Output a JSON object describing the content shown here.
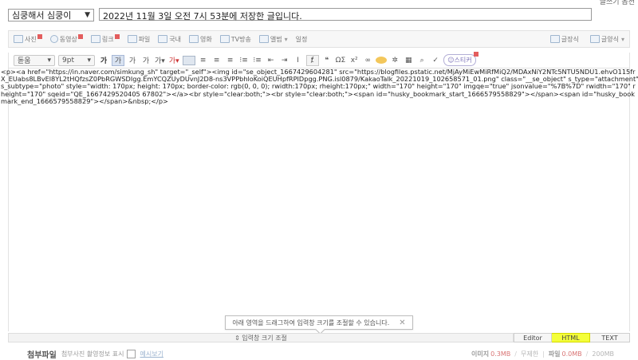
{
  "top_right_text": "글쓰기 옵션",
  "post": {
    "category": "심쿵해서 심쿵이",
    "title": "2022년 11월 3일 오전 7시 53분에 저장한 글입니다."
  },
  "toolbar1": {
    "items": [
      {
        "label": "사진",
        "icon": "camera-icon",
        "new": true
      },
      {
        "label": "동영상",
        "icon": "video-icon",
        "new": true
      },
      {
        "label": "링크",
        "icon": "link-icon",
        "new": true
      },
      {
        "label": "파일",
        "icon": "file-icon"
      },
      {
        "label": "국내",
        "icon": "map-icon"
      },
      {
        "label": "영화",
        "icon": "film-icon"
      },
      {
        "label": "TV방송",
        "icon": "tv-icon"
      },
      {
        "label": "앨범",
        "icon": "album-icon"
      },
      {
        "label": "일정",
        "icon": "calendar-icon"
      }
    ],
    "right": [
      {
        "label": "글장식",
        "icon": "decorate-icon"
      },
      {
        "label": "글양식",
        "icon": "template-icon"
      }
    ]
  },
  "toolbar2": {
    "font": "돋움",
    "size": "9pt",
    "sticker": "스티커"
  },
  "editor": {
    "html_source": "<p><a href=\"https://in.naver.com/simkung_sh\" target=\"_self\"><img id=\"se_object_1667429604281\" src=\"https://blogfiles.pstatic.net/MjAyMiEwMiRfMiQ2/MDAxNiY2NTc5NTU5NDU1.ehvO115frX_EUabs8LBvEl8YL2tHQfzsZ0PbRGWSDIgg.EmYCQZUyDUvnJ2D8-ns3VPPbhloKoiQEUHpfRPIDpgg.PNG.isl0879/KakaoTalk_20221019_102658571_01.png\" class=\"__se_object\" s_type=\"attachment\" s_subtype=\"photo\" style=\"width: 170px; height: 170px; border-color: rgb(0, 0, 0); rwidth:170px; rheight:170px;\" width=\"170\" height=\"170\" imgqe=\"true\" jsonvalue=\"%7B%7D\" rwidth=\"170\" rheight=\"170\" sqeid=\"QE_1667429520405 67802\"></a><br style=\"clear:both;\"><br style=\"clear:both;\"><span id=\"husky_bookmark_start_1666579558829\"></span><span id=\"husky_bookmark_end_1666579558829\"></span>&nbsp;</p>"
  },
  "tooltip": {
    "text": "아래 영역을 드래그하여 입력창 크기를 조절할 수 있습니다.",
    "close": "✕"
  },
  "resize_bar": "⇕ 입력창 크기 조절",
  "modes": {
    "editor": "Editor",
    "html": "HTML",
    "text": "TEXT",
    "active": "HTML"
  },
  "attachment": {
    "label": "첨부파일",
    "option": "첨부사진 촬영정보 표시",
    "example": "예시보기",
    "image_label": "이미지",
    "image_value": "0.3MB",
    "image_limit": "무제한",
    "file_label": "파일",
    "file_value": "0.0MB",
    "file_limit": "200MB"
  },
  "colors": {
    "highlight": "#f4ff3a",
    "badge": "#e35d5d"
  }
}
